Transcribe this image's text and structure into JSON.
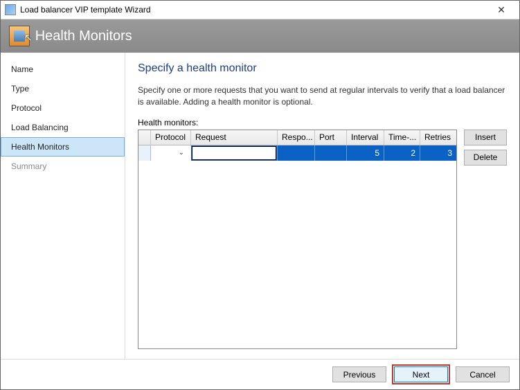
{
  "window": {
    "title": "Load balancer VIP template Wizard"
  },
  "banner": {
    "title": "Health Monitors"
  },
  "sidebar": {
    "items": [
      {
        "label": "Name"
      },
      {
        "label": "Type"
      },
      {
        "label": "Protocol"
      },
      {
        "label": "Load Balancing"
      },
      {
        "label": "Health Monitors"
      },
      {
        "label": "Summary"
      }
    ]
  },
  "content": {
    "heading": "Specify a health monitor",
    "description": "Specify one or more requests that you want to send at regular intervals to verify that a load balancer is available. Adding a health monitor is optional.",
    "grid_label": "Health monitors:",
    "columns": {
      "protocol": "Protocol",
      "request": "Request",
      "response": "Respo...",
      "port": "Port",
      "interval": "Interval",
      "timeout": "Time-...",
      "retries": "Retries"
    },
    "row": {
      "protocol": "",
      "request": "",
      "response": "",
      "port": "",
      "interval": "5",
      "timeout": "2",
      "retries": "3"
    }
  },
  "buttons": {
    "insert": "Insert",
    "delete": "Delete",
    "previous": "Previous",
    "next": "Next",
    "cancel": "Cancel"
  }
}
